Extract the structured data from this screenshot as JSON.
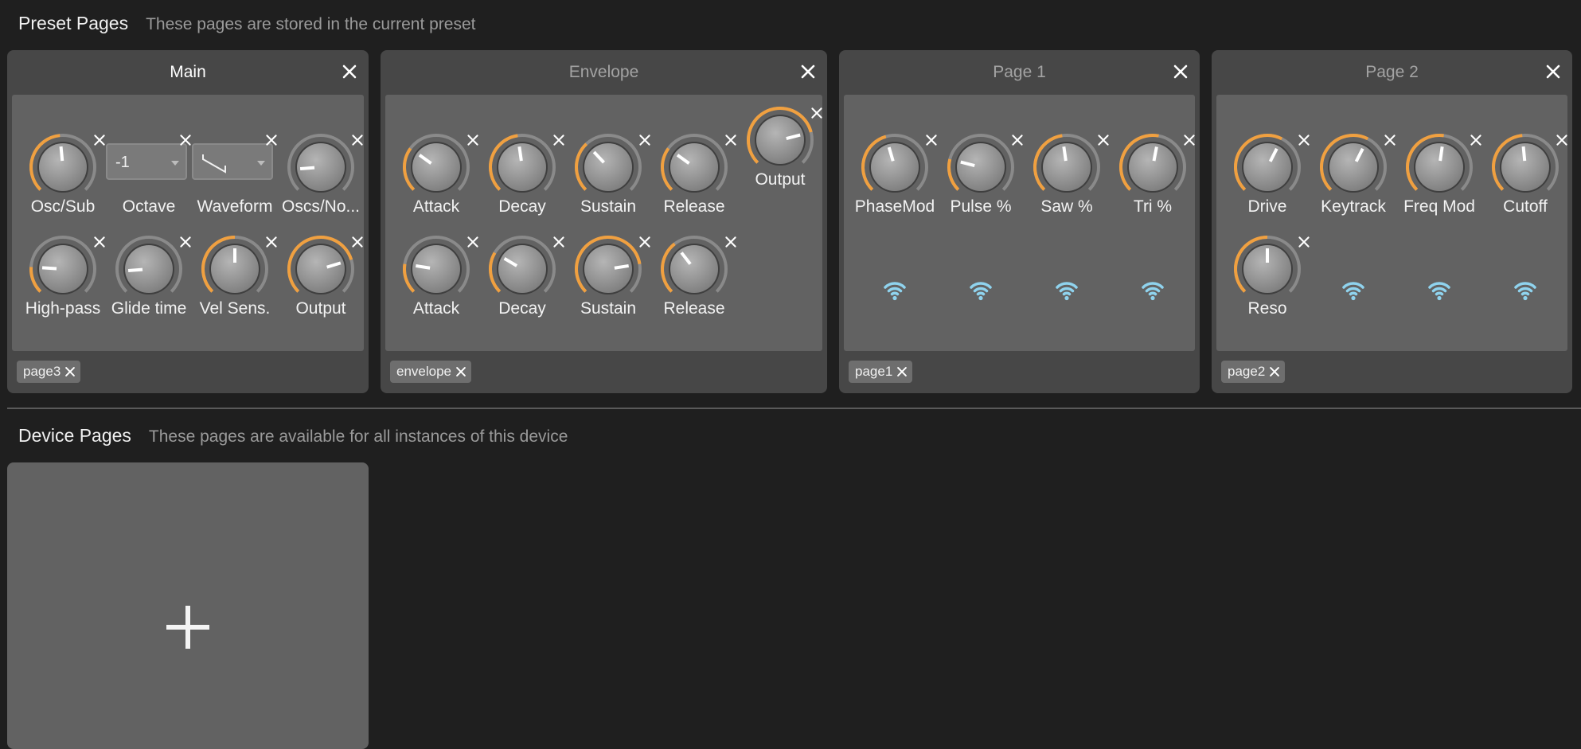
{
  "preset_section": {
    "title": "Preset Pages",
    "description": "These pages are stored in the current preset"
  },
  "device_section": {
    "title": "Device Pages",
    "description": "These pages are available for all instances of this device"
  },
  "colors": {
    "accent": "#f0a040",
    "wifi": "#8fd3ee",
    "background": "#1f1f1f",
    "card": "#474747",
    "panel": "#626262"
  },
  "cards": [
    {
      "title": "Main",
      "active": true,
      "tag": "page3",
      "slots": [
        {
          "label": "Osc/Sub",
          "type": "knob",
          "value": 0.48
        },
        {
          "label": "Octave",
          "type": "dropdown",
          "value": "-1"
        },
        {
          "label": "Waveform",
          "type": "waveform",
          "icon": "saw-wave-icon"
        },
        {
          "label": "Oscs/No...",
          "type": "knob",
          "value": 0.15,
          "empty_ring": true
        },
        {
          "label": "High-pass",
          "type": "knob",
          "value": 0.18
        },
        {
          "label": "Glide time",
          "type": "knob",
          "value": 0.15,
          "empty_ring": true
        },
        {
          "label": "Vel Sens.",
          "type": "knob",
          "value": 0.5
        },
        {
          "label": "Output",
          "type": "knob",
          "value": 0.77
        }
      ]
    },
    {
      "title": "Envelope",
      "active": false,
      "tag": "envelope",
      "slots": [
        {
          "label": "Attack",
          "type": "knob",
          "value": 0.3
        },
        {
          "label": "Decay",
          "type": "knob",
          "value": 0.47
        },
        {
          "label": "Sustain",
          "type": "knob",
          "value": 0.34
        },
        {
          "label": "Release",
          "type": "knob",
          "value": 0.3
        },
        {
          "label": "Output",
          "type": "knob",
          "value": 0.78,
          "raised": true
        },
        {
          "label": "Attack",
          "type": "knob",
          "value": 0.2
        },
        {
          "label": "Decay",
          "type": "knob",
          "value": 0.28
        },
        {
          "label": "Sustain",
          "type": "knob",
          "value": 0.8
        },
        {
          "label": "Release",
          "type": "knob",
          "value": 0.36
        }
      ]
    },
    {
      "title": "Page 1",
      "active": false,
      "tag": "page1",
      "slots": [
        {
          "label": "PhaseMod",
          "type": "knob",
          "value": 0.44
        },
        {
          "label": "Pulse %",
          "type": "knob",
          "value": 0.22
        },
        {
          "label": "Saw %",
          "type": "knob",
          "value": 0.47
        },
        {
          "label": "Tri %",
          "type": "knob",
          "value": 0.54
        },
        {
          "type": "empty"
        },
        {
          "type": "empty"
        },
        {
          "type": "empty"
        },
        {
          "type": "empty"
        }
      ]
    },
    {
      "title": "Page 2",
      "active": false,
      "tag": "page2",
      "slots": [
        {
          "label": "Drive",
          "type": "knob",
          "value": 0.6
        },
        {
          "label": "Keytrack",
          "type": "knob",
          "value": 0.6
        },
        {
          "label": "Freq Mod",
          "type": "knob",
          "value": 0.53
        },
        {
          "label": "Cutoff",
          "type": "knob",
          "value": 0.48
        },
        {
          "label": "Reso",
          "type": "knob",
          "value": 0.5
        },
        {
          "type": "empty"
        },
        {
          "type": "empty"
        },
        {
          "type": "empty"
        }
      ]
    }
  ],
  "add_page": {
    "icon": "plus-icon"
  }
}
